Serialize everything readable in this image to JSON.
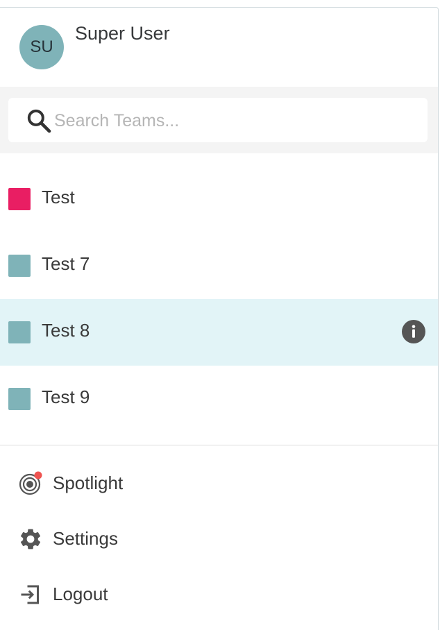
{
  "user": {
    "initials": "SU",
    "name": "Super User",
    "avatar_color": "#7fb3b8"
  },
  "search": {
    "placeholder": "Search Teams..."
  },
  "teams": [
    {
      "name": "Test",
      "color": "#e91e63"
    },
    {
      "name": "Test 7",
      "color": "#7fb3b8"
    },
    {
      "name": "Test 8",
      "color": "#7fb3b8",
      "selected": true,
      "icon": "info-icon"
    },
    {
      "name": "Test 9",
      "color": "#7fb3b8"
    }
  ],
  "menu": [
    {
      "label": "Spotlight",
      "icon": "spotlight-icon",
      "badge_color": "#ef5350"
    },
    {
      "label": "Settings",
      "icon": "gear-icon"
    },
    {
      "label": "Logout",
      "icon": "logout-icon"
    }
  ],
  "colors": {
    "selected_row": "#e2f4f7",
    "search_band": "#f4f4f4",
    "icon_gray": "#555555"
  }
}
